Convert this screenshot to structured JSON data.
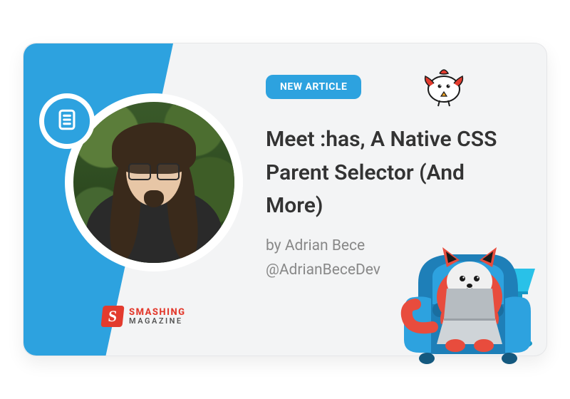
{
  "badge": {
    "label": "NEW ARTICLE"
  },
  "article": {
    "title": "Meet :has, A Native CSS Parent Selector (And More)",
    "byline": "by Adrian Bece",
    "handle": "@AdrianBeceDev"
  },
  "brand": {
    "mark_letter": "S",
    "line1": "SMASHING",
    "line2": "MAGAZINE"
  },
  "icons": {
    "document": "document-icon",
    "bird": "bird-icon",
    "mascot": "cat-mascot-icon"
  },
  "colors": {
    "accent_blue": "#2da2df",
    "brand_red": "#e33b2e",
    "text_dark": "#333333",
    "text_muted": "#888888",
    "card_bg": "#f3f4f5"
  }
}
